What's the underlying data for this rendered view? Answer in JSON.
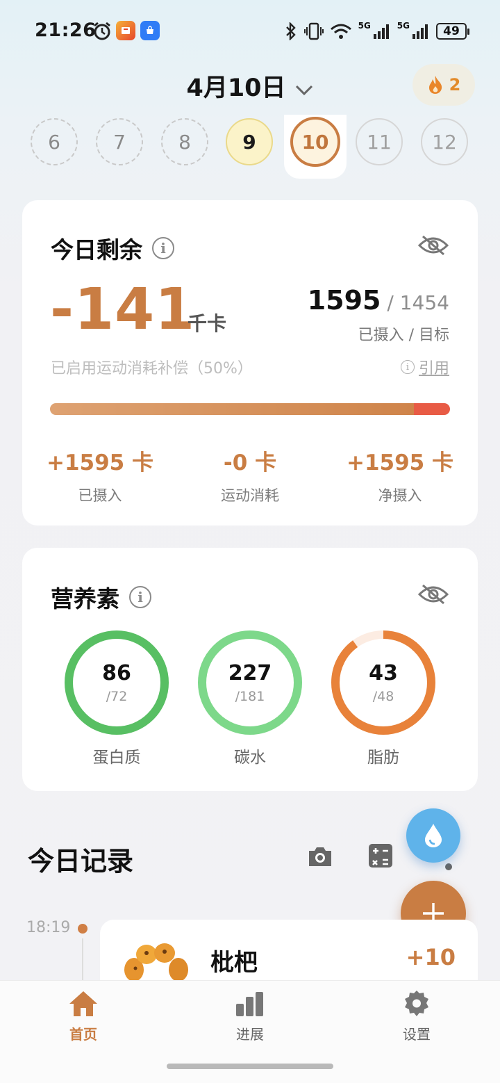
{
  "status_bar": {
    "time": "21:26",
    "battery": "49",
    "network": "5G"
  },
  "header": {
    "date": "4月10日",
    "streak_count": "2"
  },
  "days": [
    "6",
    "7",
    "8",
    "9",
    "10",
    "11",
    "12"
  ],
  "selected_day": "10",
  "remaining_card": {
    "title": "今日剩余",
    "remaining_value": "-141",
    "remaining_unit": "千卡",
    "intake": "1595",
    "target": "1454",
    "intake_label": "已摄入 / 目标",
    "compensation_note": "已启用运动消耗补偿（50%）",
    "cite_label": "引用",
    "progress_fraction": 0.91,
    "stats": [
      {
        "value": "+1595 卡",
        "label": "已摄入"
      },
      {
        "value": "-0 卡",
        "label": "运动消耗"
      },
      {
        "value": "+1595 卡",
        "label": "净摄入"
      }
    ]
  },
  "nutrients_card": {
    "title": "营养素",
    "items": [
      {
        "value": "86",
        "goal": "/72",
        "label": "蛋白质",
        "fraction": 1.0,
        "color": "#58bf63"
      },
      {
        "value": "227",
        "goal": "/181",
        "label": "碳水",
        "fraction": 1.0,
        "color": "#7dd88a"
      },
      {
        "value": "43",
        "goal": "/48",
        "label": "脂肪",
        "fraction": 0.9,
        "color": "#e8823a"
      }
    ]
  },
  "records": {
    "title": "今日记录",
    "entries": [
      {
        "time": "18:19",
        "name": "枇杷",
        "kcal": "+10"
      }
    ]
  },
  "nav": {
    "items": [
      {
        "label": "首页",
        "icon": "home-icon"
      },
      {
        "label": "进展",
        "icon": "bar-chart-icon"
      },
      {
        "label": "设置",
        "icon": "gear-icon"
      }
    ]
  },
  "colors": {
    "accent": "#c97d43",
    "over": "#e85b45",
    "water": "#5fb3ea"
  }
}
